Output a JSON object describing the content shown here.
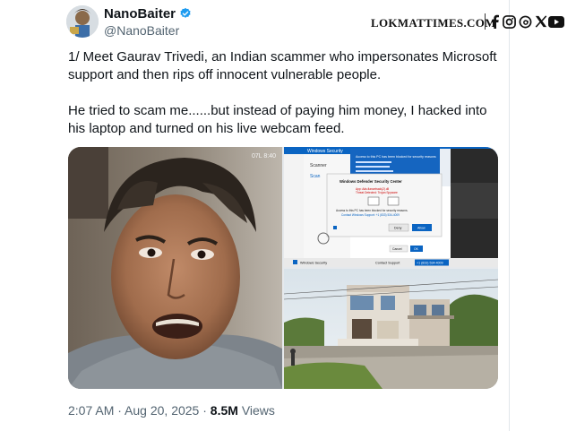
{
  "tweet": {
    "author_name": "NanoBaiter",
    "author_handle": "@NanoBaiter",
    "verified_color": "#1d9bf0",
    "text_paragraphs": [
      "1/ Meet Gaurav Trivedi, an Indian scammer who impersonates Microsoft support and then rips off innocent vulnerable people.",
      "He tried to scam me......but instead of paying him money, I hacked into his laptop and turned on his live webcam feed."
    ],
    "time": "2:07 AM",
    "date": "Aug 20, 2025",
    "views_count": "8.5M",
    "views_label": "Views",
    "media": [
      {
        "kind": "webcam-photo",
        "corner_text": "07L 8:40"
      },
      {
        "kind": "fake-windows-security-screenshot",
        "window_title": "Windows Security",
        "banner_text": "Access to this PC has been blocked for security reasons",
        "dialog_title": "Windows Defender Security Center",
        "dialog_line1": "App: Ads.fiancetrack(2).dll",
        "dialog_line2": "Threat Detected: Trojan Spyware",
        "dialog_line3": "Access to this PC has been blocked for security reasons.",
        "dialog_line4": "Contact Windows Support: +1 (833) 534-4009",
        "deny_label": "Deny",
        "allow_label": "Allow",
        "cancel_label": "Cancel",
        "ok_label": "OK",
        "footer_left": "Windows Security",
        "footer_mid": "Contact Support",
        "footer_number": "+1 (833) 534-4009",
        "side_items": [
          "Scanner",
          "Scan"
        ],
        "accent": "#0078d4"
      },
      {
        "kind": "house-photo"
      }
    ]
  },
  "watermark": {
    "brand": "LOKMATTIMES.COM",
    "social_icons": [
      "facebook-icon",
      "instagram-icon",
      "threads-icon",
      "x-icon",
      "youtube-icon"
    ]
  }
}
